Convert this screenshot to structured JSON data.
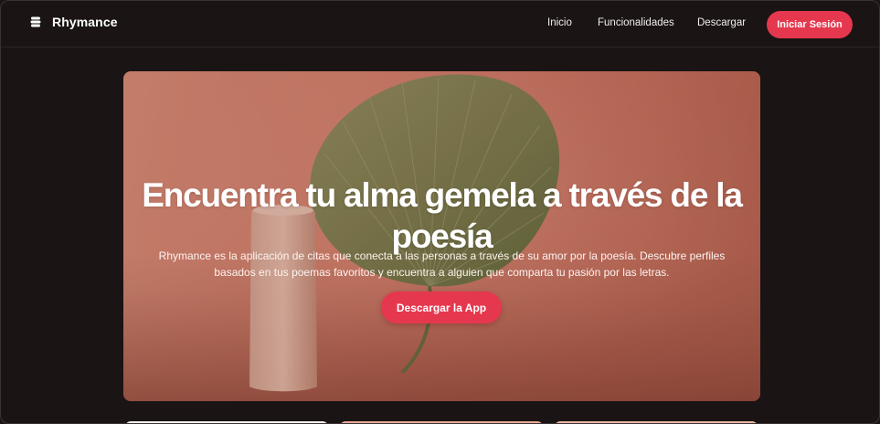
{
  "navbar": {
    "brand_name": "Rhymance",
    "brand_icon": "stack-icon",
    "links": [
      "Inicio",
      "Funcionalidades",
      "Descargar"
    ],
    "login_label": "Iniciar Sesión"
  },
  "hero": {
    "title": "Encuentra tu alma gemela a través de la poesía",
    "description": "Rhymance es la aplicación de citas que conecta a las personas a través de su amor por la poesía. Descubre perfiles basados en tus poemas favoritos y encuentra a alguien que comparta tu pasión por las letras.",
    "cta_label": "Descargar la App"
  },
  "colors": {
    "accent": "#e5384e",
    "background": "#1a1414",
    "hero_bg": "#d27c69"
  }
}
